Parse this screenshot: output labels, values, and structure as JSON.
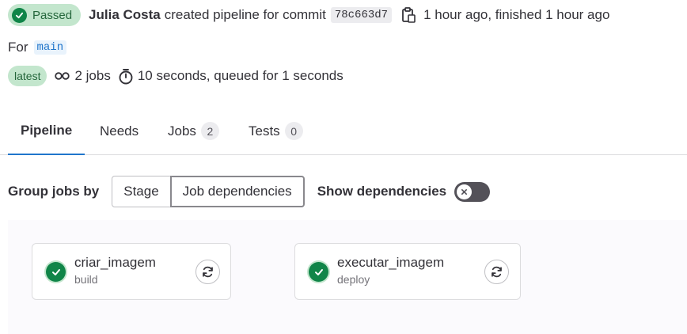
{
  "header": {
    "status_label": "Passed",
    "author": "Julia Costa",
    "action_text": "created pipeline for commit",
    "commit_sha": "78c663d7",
    "time_text": "1 hour ago, finished 1 hour ago",
    "for_label": "For",
    "ref": "main",
    "latest_badge": "latest",
    "jobs_text": "2 jobs",
    "duration_text": "10 seconds, queued for 1 seconds"
  },
  "tabs": [
    {
      "label": "Pipeline"
    },
    {
      "label": "Needs"
    },
    {
      "label": "Jobs",
      "count": "2"
    },
    {
      "label": "Tests",
      "count": "0"
    }
  ],
  "controls": {
    "group_label": "Group jobs by",
    "stage_button": "Stage",
    "job_dependencies_button": "Job dependencies",
    "show_dependencies_label": "Show dependencies"
  },
  "jobs": [
    {
      "name": "criar_imagem",
      "stage": "build",
      "status": "passed"
    },
    {
      "name": "executar_imagem",
      "stage": "deploy",
      "status": "passed"
    }
  ],
  "colors": {
    "success": "#108548",
    "success_light": "#c3e6cd",
    "link": "#1f75cb"
  }
}
